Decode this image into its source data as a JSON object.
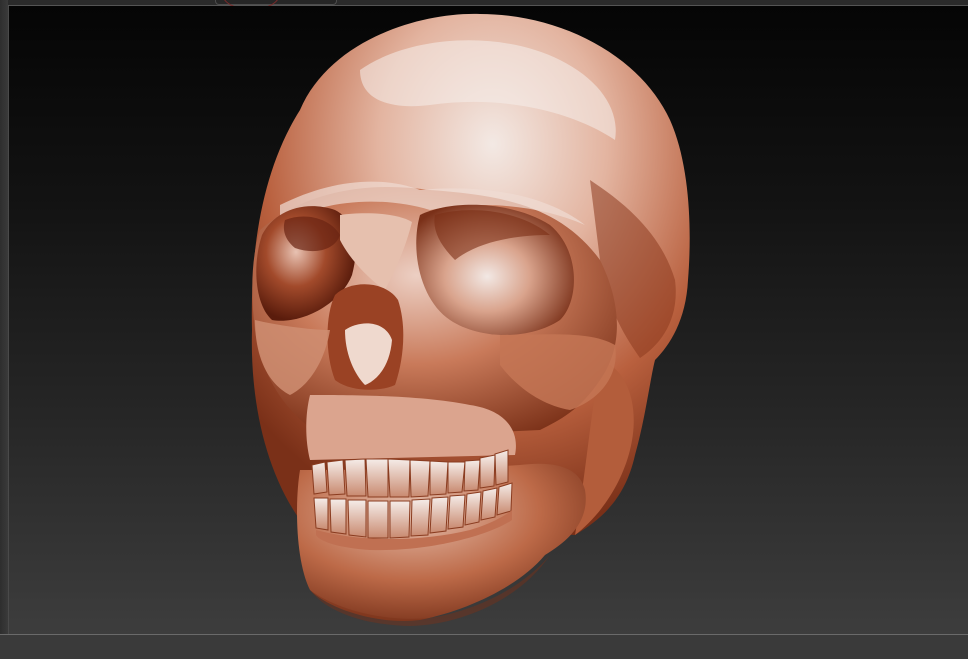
{
  "app": {
    "name": "",
    "view": "3d-sculpt-viewport"
  },
  "model": {
    "subject": "skull",
    "material_color": "#b3583a",
    "highlight_color": "#f1e6e0"
  },
  "theme": {
    "background_top": "#050505",
    "background_bottom": "#3d3d3d",
    "chrome": "#3a3a3a",
    "brush_ring": "#7a2a2a"
  }
}
